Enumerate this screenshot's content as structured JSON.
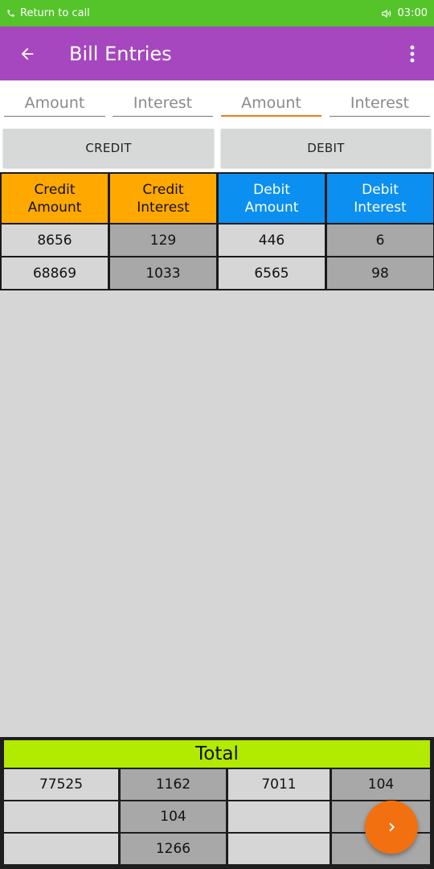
{
  "status_bar": {
    "call_text": "Return to call",
    "time": "03:00",
    "icons": [
      "phone-icon",
      "speaker-icon"
    ]
  },
  "app_bar": {
    "title": "Bill Entries",
    "icons": [
      "back-arrow-icon",
      "more-vert-icon"
    ],
    "color": "#a647bf"
  },
  "inputs": [
    {
      "placeholder": "Amount",
      "value": ""
    },
    {
      "placeholder": "Interest",
      "value": ""
    },
    {
      "placeholder": "Amount",
      "value": ""
    },
    {
      "placeholder": "Interest",
      "value": ""
    }
  ],
  "buttons": {
    "credit": "CREDIT",
    "debit": "DEBIT"
  },
  "table": {
    "headers": [
      {
        "line1": "Credit",
        "line2": "Amount"
      },
      {
        "line1": "Credit",
        "line2": "Interest"
      },
      {
        "line1": "Debit",
        "line2": "Amount"
      },
      {
        "line1": "Debit",
        "line2": "Interest"
      }
    ],
    "rows": [
      [
        "8656",
        "129",
        "446",
        "6"
      ],
      [
        "68869",
        "1033",
        "6565",
        "98"
      ]
    ]
  },
  "total": {
    "label": "Total",
    "rows": [
      [
        "77525",
        "1162",
        "7011",
        "104"
      ],
      [
        "",
        "104",
        "",
        ""
      ],
      [
        "",
        "1266",
        "",
        ""
      ]
    ]
  },
  "colors": {
    "status_bar": "#55c42b",
    "credit_header": "#ffa800",
    "debit_header": "#0b8ff0",
    "total_header": "#b2ea00",
    "fab": "#f2700f",
    "input_focus": "#ef7a14"
  },
  "fab": {
    "icon": "chevron-right-icon"
  }
}
